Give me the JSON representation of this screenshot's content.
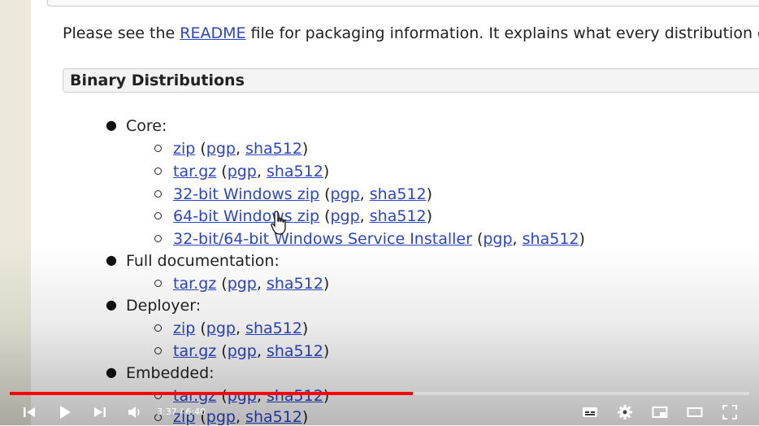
{
  "intro": {
    "before": "Please see the ",
    "link": "README",
    "after": " file for packaging information. It explains what every distribution c"
  },
  "section": {
    "title": "Binary Distributions"
  },
  "groups": [
    {
      "label": "Core:",
      "subitems": [
        {
          "main": "zip",
          "pgp": "pgp",
          "sha": "sha512"
        },
        {
          "main": "tar.gz",
          "pgp": "pgp",
          "sha": "sha512"
        },
        {
          "main": "32-bit Windows zip",
          "pgp": "pgp",
          "sha": "sha512"
        },
        {
          "main": "64-bit Windows zip",
          "pgp": "pgp",
          "sha": "sha512"
        },
        {
          "main": "32-bit/64-bit Windows Service Installer",
          "pgp": "pgp",
          "sha": "sha512"
        }
      ]
    },
    {
      "label": "Full documentation:",
      "subitems": [
        {
          "main": "tar.gz",
          "pgp": "pgp",
          "sha": "sha512"
        }
      ]
    },
    {
      "label": "Deployer:",
      "subitems": [
        {
          "main": "zip",
          "pgp": "pgp",
          "sha": "sha512"
        },
        {
          "main": "tar.gz",
          "pgp": "pgp",
          "sha": "sha512"
        }
      ]
    },
    {
      "label": "Embedded:",
      "subitems": [
        {
          "main": "tar.gz",
          "pgp": "pgp",
          "sha": "sha512"
        },
        {
          "main": "zip",
          "pgp": "pgp",
          "sha": "sha512"
        }
      ]
    }
  ],
  "player": {
    "time": "3:37 / 6:40",
    "progress_fraction": 0.545,
    "accent": "#ff0000",
    "icons": [
      "previous-icon",
      "play-icon",
      "next-icon",
      "volume-icon",
      "subtitles-icon",
      "settings-icon",
      "miniplayer-icon",
      "theater-icon",
      "fullscreen-icon"
    ]
  }
}
